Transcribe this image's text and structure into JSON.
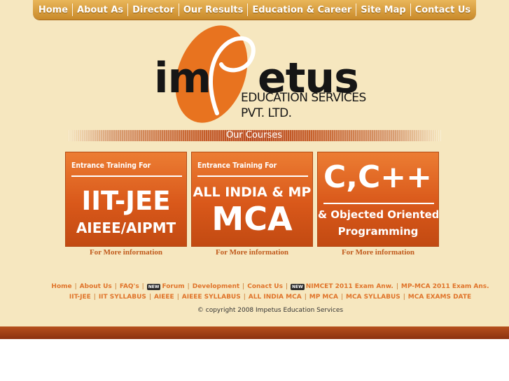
{
  "nav": {
    "items": [
      "Home",
      "About As",
      "Director",
      "Our Results",
      "Education & Career",
      "Site Map",
      "Contact Us"
    ]
  },
  "logo": {
    "word_left": "im",
    "word_right": "etus",
    "letter_p": "p",
    "line1": "EDUCATION SERVICES",
    "line2": "PVT. LTD."
  },
  "courses_header": "Our Courses",
  "cards": [
    {
      "small": "Entrance Training For",
      "big1": "IIT-JEE",
      "big2": "AIEEE/AIPMT"
    },
    {
      "small": "Entrance Training For",
      "big1": "ALL INDIA & MP",
      "big2": "MCA"
    },
    {
      "big1": "C,C++",
      "big2": "& Objected Oriented",
      "big3": "Programming"
    }
  ],
  "more_info": "For More information",
  "footer": {
    "row1": [
      "Home",
      "About Us",
      "FAQ's",
      "Forum",
      "Development",
      "Conact Us",
      "NIMCET 2011 Exam Anw.",
      "MP-MCA 2011 Exam Ans."
    ],
    "row2": [
      "IIT-JEE",
      "IIT SYLLABUS",
      "AIEEE",
      "AIEEE SYLLABUS",
      "ALL INDIA MCA",
      "MP MCA",
      "MCA SYLLABUS",
      "MCA EXAMS DATE"
    ],
    "new_badge": "NEW",
    "copyright": "© copyright 2008 Impetus Education Services"
  },
  "colors": {
    "page_bg": "#f6e7bf",
    "nav_gold": "#d9a040",
    "brand_orange": "#e8731f",
    "card_orange": "#d9581a",
    "link_orange": "#e0742a",
    "bottom_bar": "#a3421a"
  }
}
